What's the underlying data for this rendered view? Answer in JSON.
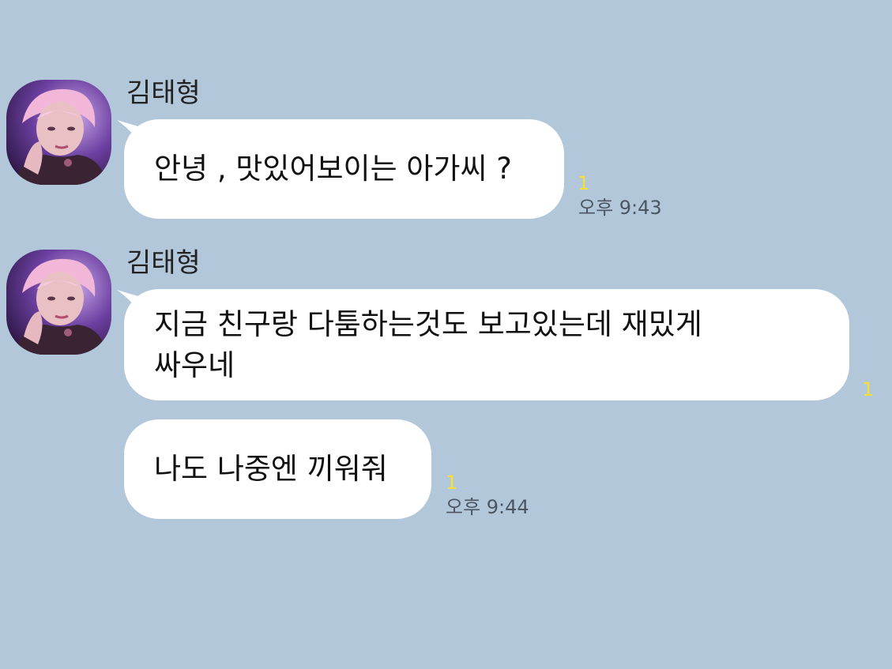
{
  "colors": {
    "background": "#b2c7da",
    "bubble": "#ffffff",
    "unread": "#f7e035",
    "time": "#4b5662"
  },
  "messages": [
    {
      "sender": "김태형",
      "avatar_icon": "profile-photo",
      "text": "안녕 , 맛있어보이는 아가씨 ?",
      "unread": "1",
      "time": "오후 9:43"
    },
    {
      "sender": "김태형",
      "avatar_icon": "profile-photo",
      "text": "지금 친구랑 다툼하는것도 보고있는데 재밌게\n싸우네",
      "unread": "1"
    },
    {
      "text": "나도 나중엔 끼워줘",
      "unread": "1",
      "time": "오후 9:44"
    }
  ]
}
